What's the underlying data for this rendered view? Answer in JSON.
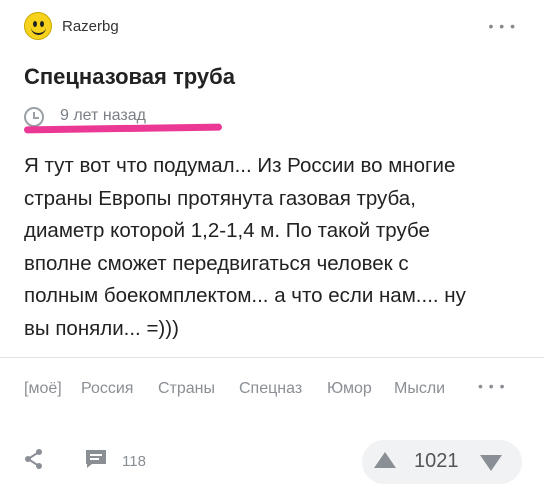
{
  "post": {
    "author": "Razerbg",
    "title": "Спецназовая труба",
    "time": "9 лет назад",
    "body": "Я тут вот что подумал... Из России во многие\nстраны Европы протянута газовая труба,\nдиаметр которой 1,2-1,4 м. По такой трубе\nвполне сможет передвигаться человек с\nполным боекомплектом... а что если нам.... ну\nвы поняли... =)))"
  },
  "header": {
    "menu": "• • •"
  },
  "tags": {
    "items": [
      "[моё]",
      "Россия",
      "Страны",
      "Спецназ",
      "Юмор",
      "Мысли"
    ],
    "more": "• • •"
  },
  "footer": {
    "comments_count": "118",
    "rating": "1021"
  },
  "colors": {
    "highlight": "#ea2d8f",
    "avatar": "#f6d21d"
  }
}
